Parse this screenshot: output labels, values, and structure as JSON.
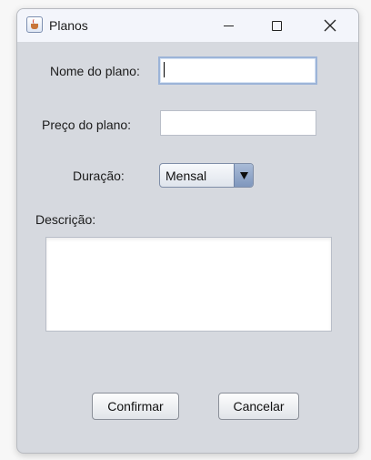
{
  "window": {
    "title": "Planos",
    "icon": "java-coffee-icon",
    "controls": [
      "minimize-icon",
      "maximize-icon",
      "close-icon"
    ]
  },
  "form": {
    "nome_label": "Nome do plano:",
    "nome_value": "",
    "preco_label": "Preço do plano:",
    "preco_value": "",
    "duracao_label": "Duração:",
    "duracao_selected": "Mensal",
    "descricao_label": "Descrição:",
    "descricao_value": ""
  },
  "buttons": {
    "confirm_label": "Confirmar",
    "cancel_label": "Cancelar"
  },
  "colors": {
    "window_bg": "#d6d9df",
    "titlebar_bg": "#f3f5fb",
    "focus_border": "#9cb4d8",
    "combo_arrow": "#7f97bd"
  }
}
